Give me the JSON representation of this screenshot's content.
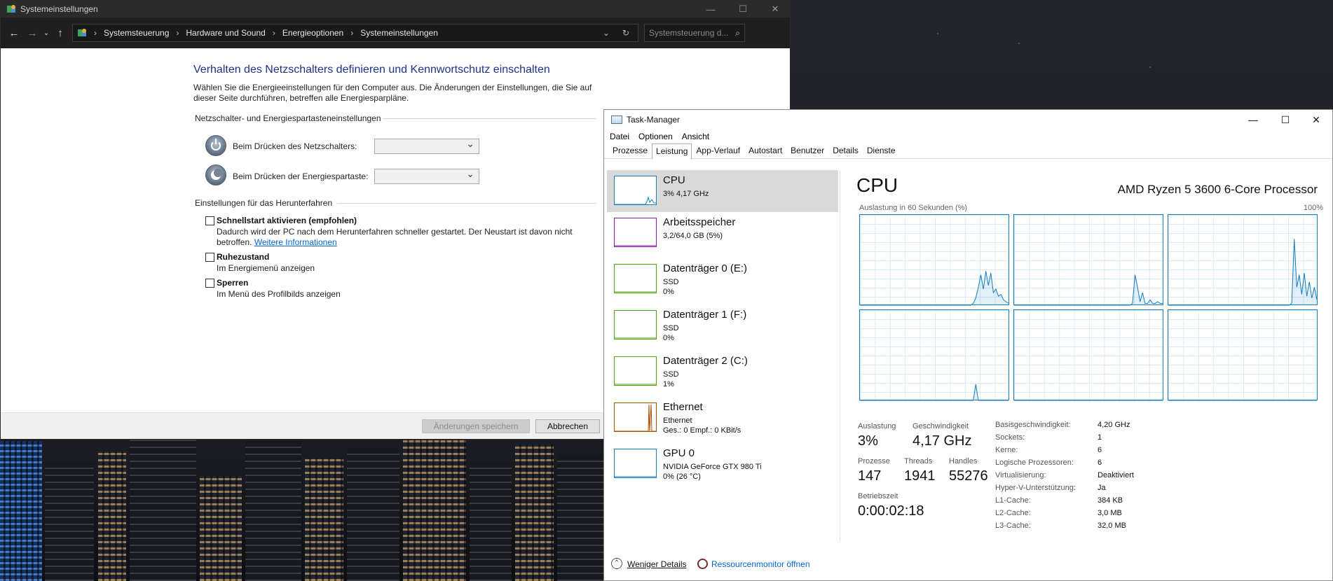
{
  "control_panel": {
    "window_title": "Systemeinstellungen",
    "breadcrumb": [
      "Systemsteuerung",
      "Hardware und Sound",
      "Energieoptionen",
      "Systemeinstellungen"
    ],
    "search_placeholder": "Systemsteuerung d...",
    "heading": "Verhalten des Netzschalters definieren und Kennwortschutz einschalten",
    "description": "Wählen Sie die Energieeinstellungen für den Computer aus. Die Änderungen der Einstellungen, die Sie auf dieser Seite durchführen, betreffen alle Energiesparpläne.",
    "power_group_label": "Netzschalter- und Energiespartasteneinstellungen",
    "power_button_label": "Beim Drücken des Netzschalters:",
    "sleep_button_label": "Beim Drücken der Energiespartaste:",
    "shutdown_group_label": "Einstellungen für das Herunterfahren",
    "fast_startup_label": "Schnellstart aktivieren (empfohlen)",
    "fast_startup_desc": "Dadurch wird der PC nach dem Herunterfahren schneller gestartet. Der Neustart ist davon nicht betroffen.",
    "more_info_link": "Weitere Informationen",
    "hibernate_label": "Ruhezustand",
    "hibernate_desc": "Im Energiemenü anzeigen",
    "lock_label": "Sperren",
    "lock_desc": "Im Menü des Profilbilds anzeigen",
    "save_button": "Änderungen speichern",
    "cancel_button": "Abbrechen"
  },
  "task_manager": {
    "window_title": "Task-Manager",
    "menu": [
      "Datei",
      "Optionen",
      "Ansicht"
    ],
    "tabs": [
      "Prozesse",
      "Leistung",
      "App-Verlauf",
      "Autostart",
      "Benutzer",
      "Details",
      "Dienste"
    ],
    "active_tab": "Leistung",
    "side_items": [
      {
        "title": "CPU",
        "line1": "3% 4,17 GHz",
        "line2": "",
        "color": "#117dbb"
      },
      {
        "title": "Arbeitsspeicher",
        "line1": "3,2/64,0 GB (5%)",
        "line2": "",
        "color": "#8b12ae"
      },
      {
        "title": "Datenträger 0 (E:)",
        "line1": "SSD",
        "line2": "0%",
        "color": "#4da60c"
      },
      {
        "title": "Datenträger 1 (F:)",
        "line1": "SSD",
        "line2": "0%",
        "color": "#4da60c"
      },
      {
        "title": "Datenträger 2 (C:)",
        "line1": "SSD",
        "line2": "1%",
        "color": "#4da60c"
      },
      {
        "title": "Ethernet",
        "line1": "Ethernet",
        "line2": "Ges.: 0 Empf.: 0 KBit/s",
        "color": "#a74f01"
      },
      {
        "title": "GPU 0",
        "line1": "NVIDIA GeForce GTX 980 Ti",
        "line2": "0% (26 °C)",
        "color": "#117dbb"
      }
    ],
    "cpu": {
      "heading": "CPU",
      "processor_name": "AMD Ryzen 5 3600 6-Core Processor",
      "graph_label": "Auslastung in 60 Sekunden (%)",
      "graph_max": "100%",
      "stats": {
        "utilization_label": "Auslastung",
        "utilization": "3%",
        "speed_label": "Geschwindigkeit",
        "speed": "4,17 GHz",
        "processes_label": "Prozesse",
        "processes": "147",
        "threads_label": "Threads",
        "threads": "1941",
        "handles_label": "Handles",
        "handles": "55276",
        "uptime_label": "Betriebszeit",
        "uptime": "0:00:02:18"
      },
      "info": [
        {
          "k": "Basisgeschwindigkeit:",
          "v": "4,20 GHz"
        },
        {
          "k": "Sockets:",
          "v": "1"
        },
        {
          "k": "Kerne:",
          "v": "6"
        },
        {
          "k": "Logische Prozessoren:",
          "v": "6"
        },
        {
          "k": "Virtualisierung:",
          "v": "Deaktiviert"
        },
        {
          "k": "Hyper-V-Unterstützung:",
          "v": "Ja"
        },
        {
          "k": "L1-Cache:",
          "v": "384 KB"
        },
        {
          "k": "L2-Cache:",
          "v": "3,0 MB"
        },
        {
          "k": "L3-Cache:",
          "v": "32,0 MB"
        }
      ],
      "core_usage": [
        [
          0,
          0,
          0,
          0,
          0,
          0,
          0,
          0,
          0,
          0,
          0,
          0,
          0,
          0,
          0,
          0,
          0,
          0,
          0,
          0,
          0,
          0,
          0,
          0,
          0,
          0,
          0,
          0,
          0,
          0,
          0,
          0,
          0,
          0,
          0,
          0,
          0,
          0,
          0,
          0,
          0,
          0,
          0,
          0,
          0,
          2,
          8,
          20,
          34,
          18,
          38,
          22,
          36,
          14,
          18,
          10,
          12,
          6,
          4,
          2
        ],
        [
          0,
          0,
          0,
          0,
          0,
          0,
          0,
          0,
          0,
          0,
          0,
          0,
          0,
          0,
          0,
          0,
          0,
          0,
          0,
          0,
          0,
          0,
          0,
          0,
          0,
          0,
          0,
          0,
          0,
          0,
          0,
          0,
          0,
          0,
          0,
          0,
          0,
          0,
          0,
          0,
          0,
          0,
          0,
          0,
          0,
          0,
          0,
          2,
          34,
          20,
          4,
          14,
          2,
          2,
          6,
          2,
          2,
          4,
          2,
          2
        ],
        [
          0,
          0,
          0,
          0,
          0,
          0,
          0,
          0,
          0,
          0,
          0,
          0,
          0,
          0,
          0,
          0,
          0,
          0,
          0,
          0,
          0,
          0,
          0,
          0,
          0,
          0,
          0,
          0,
          0,
          0,
          0,
          0,
          0,
          0,
          0,
          0,
          0,
          0,
          0,
          0,
          0,
          0,
          0,
          0,
          0,
          0,
          0,
          0,
          0,
          2,
          74,
          20,
          34,
          12,
          36,
          10,
          26,
          8,
          20,
          6
        ],
        [
          0,
          0,
          0,
          0,
          0,
          0,
          0,
          0,
          0,
          0,
          0,
          0,
          0,
          0,
          0,
          0,
          0,
          0,
          0,
          0,
          0,
          0,
          0,
          0,
          0,
          0,
          0,
          0,
          0,
          0,
          0,
          0,
          0,
          0,
          0,
          0,
          0,
          0,
          0,
          0,
          0,
          0,
          0,
          0,
          0,
          0,
          18,
          0,
          0,
          0,
          0,
          0,
          0,
          0,
          0,
          0,
          0,
          0,
          0,
          0
        ],
        [
          0,
          0,
          0,
          0,
          0,
          0,
          0,
          0,
          0,
          0,
          0,
          0,
          0,
          0,
          0,
          0,
          0,
          0,
          0,
          0,
          0,
          0,
          0,
          0,
          0,
          0,
          0,
          0,
          0,
          0,
          0,
          0,
          0,
          0,
          0,
          0,
          0,
          0,
          0,
          0,
          0,
          0,
          0,
          0,
          0,
          0,
          0,
          0,
          0,
          0,
          0,
          0,
          0,
          0,
          0,
          0,
          0,
          0,
          0,
          0
        ],
        [
          0,
          0,
          0,
          0,
          0,
          0,
          0,
          0,
          0,
          0,
          0,
          0,
          0,
          0,
          0,
          0,
          0,
          0,
          0,
          0,
          0,
          0,
          0,
          0,
          0,
          0,
          0,
          0,
          0,
          0,
          0,
          0,
          0,
          0,
          0,
          0,
          0,
          0,
          0,
          0,
          0,
          0,
          0,
          0,
          0,
          0,
          0,
          0,
          0,
          0,
          0,
          0,
          0,
          0,
          0,
          0,
          0,
          0,
          0,
          0
        ]
      ]
    },
    "fewer_details": "Weniger Details",
    "resource_monitor": "Ressourcenmonitor öffnen"
  }
}
